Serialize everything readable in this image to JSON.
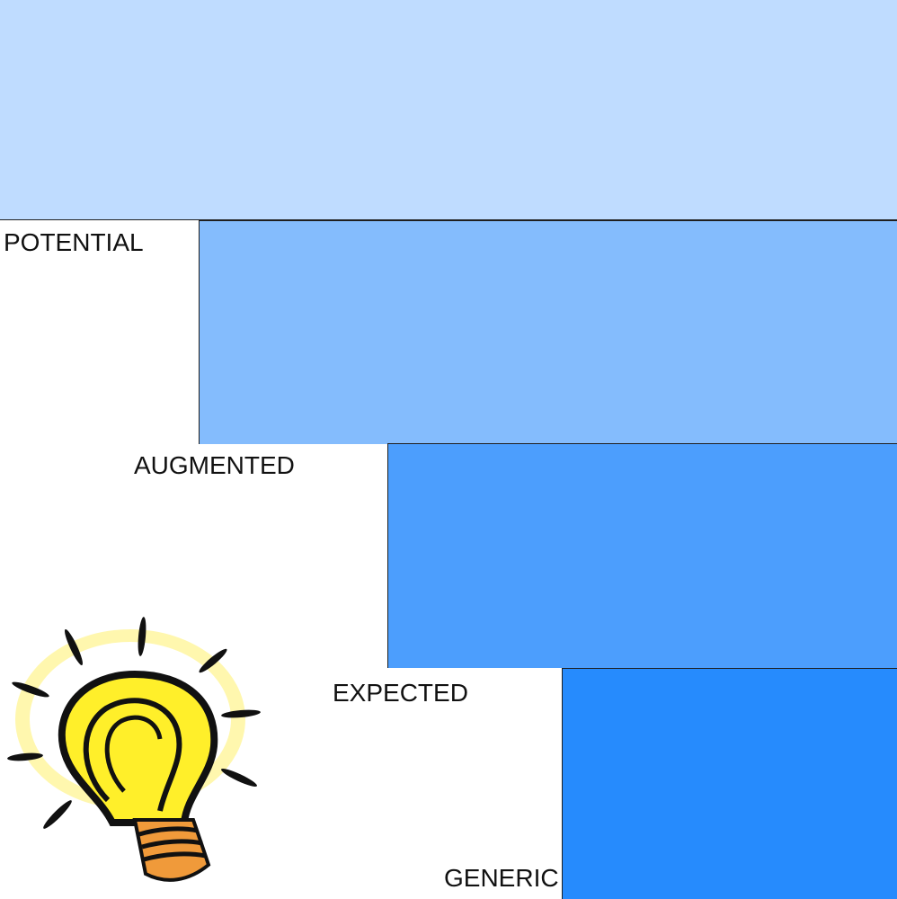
{
  "levels": [
    {
      "label": "",
      "color": "#bfdcff"
    },
    {
      "label": "POTENTIAL",
      "color": "#84bcfd"
    },
    {
      "label": "AUGMENTED",
      "color": "#4c9efd"
    },
    {
      "label": "EXPECTED",
      "color": "#268bfd"
    }
  ],
  "labels": {
    "potential": "POTENTIAL",
    "augmented": "AUGMENTED",
    "expected": "EXPECTED",
    "generic": "GENERIC"
  },
  "illustration": {
    "icon": "lightbulb-icon"
  }
}
